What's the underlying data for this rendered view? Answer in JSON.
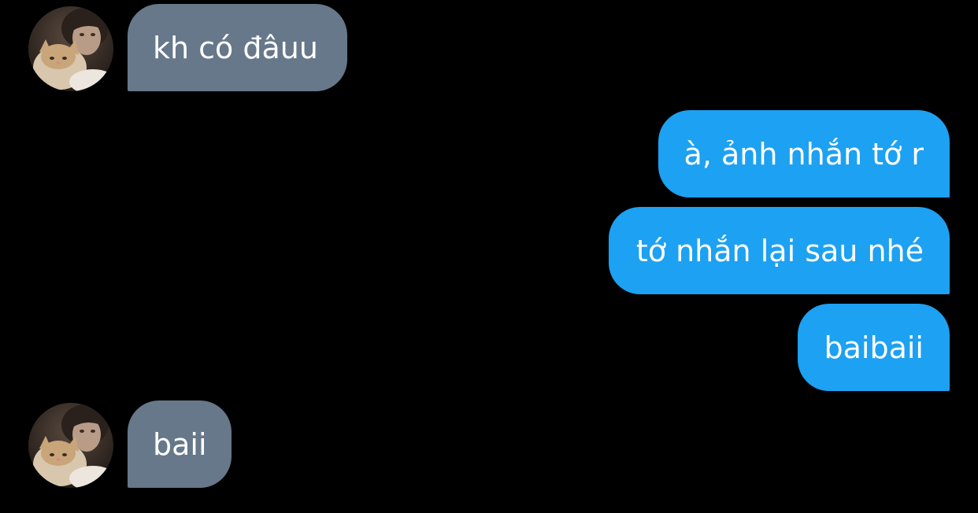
{
  "conversation": {
    "messages": [
      {
        "direction": "incoming",
        "text": "kh có đâuu",
        "avatar": "person-with-cat-avatar"
      },
      {
        "direction": "outgoing",
        "text": "à, ảnh nhắn tớ r"
      },
      {
        "direction": "outgoing",
        "text": "tớ nhắn lại sau nhé"
      },
      {
        "direction": "outgoing",
        "text": "baibaii"
      },
      {
        "direction": "incoming",
        "text": "baii",
        "avatar": "person-with-cat-avatar"
      }
    ]
  },
  "colors": {
    "background": "#000000",
    "incoming_bubble": "#66788a",
    "outgoing_bubble": "#1da1f2",
    "text": "#ffffff"
  }
}
